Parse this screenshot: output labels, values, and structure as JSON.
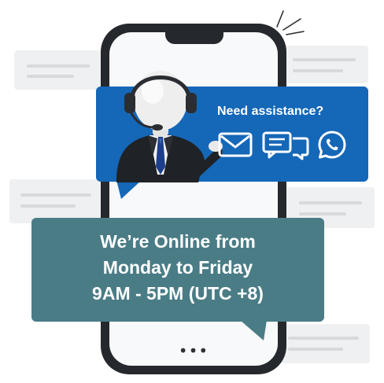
{
  "support": {
    "prompt": "Need assistance?",
    "channels": [
      {
        "name": "email",
        "icon": "envelope-icon"
      },
      {
        "name": "chat",
        "icon": "chat-bubbles-icon"
      },
      {
        "name": "whatsapp",
        "icon": "whatsapp-icon"
      }
    ]
  },
  "hours": {
    "line1": "We’re Online from",
    "line2": "Monday to Friday",
    "line3": "9AM - 5PM (UTC +8)"
  },
  "phone": {
    "indicator": "•••"
  },
  "colors": {
    "support_bubble": "#1567b8",
    "hours_bubble": "#4a7c86",
    "phone_frame": "#25282c",
    "background_bubbles": "#eef0f2"
  }
}
